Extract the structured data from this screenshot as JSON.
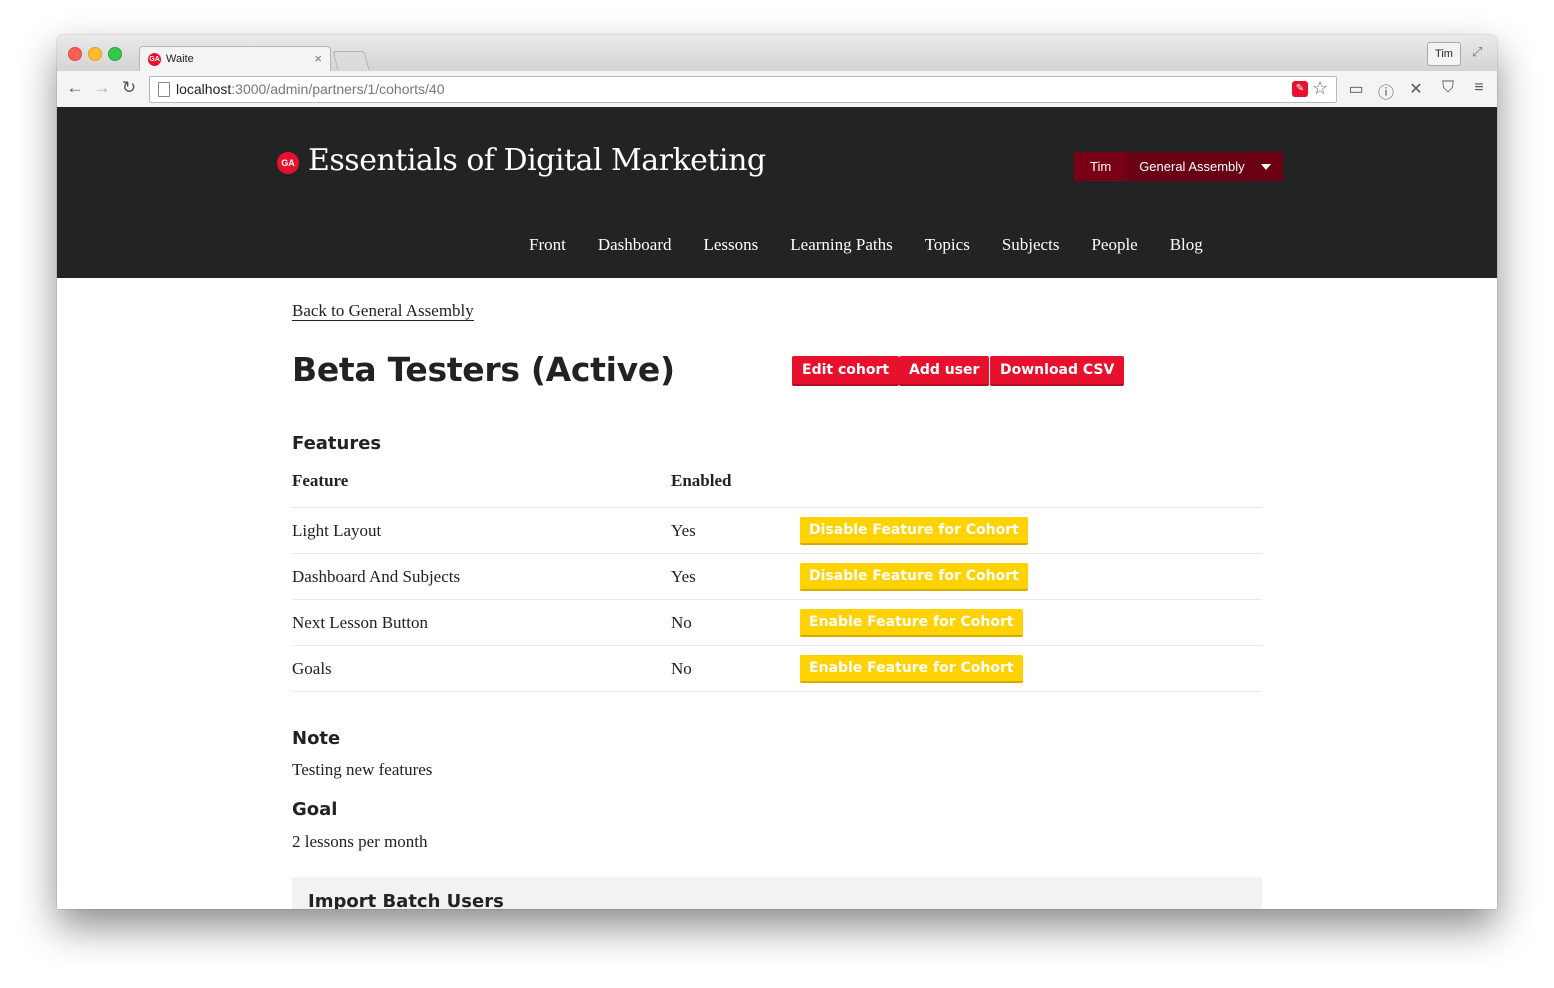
{
  "browser": {
    "tab_title": "Waite",
    "tab_favicon": "GA",
    "close_glyph": "×",
    "profile_label": "Tim",
    "url_host": "localhost",
    "url_path": ":3000/admin/partners/1/cohorts/40"
  },
  "header": {
    "logo_text": "GA",
    "site_title": "Essentials of Digital Marketing",
    "user_name": "Tim",
    "org_name": "General Assembly",
    "nav": [
      "Front",
      "Dashboard",
      "Lessons",
      "Learning Paths",
      "Topics",
      "Subjects",
      "People",
      "Blog"
    ]
  },
  "page": {
    "back_link": "Back to General Assembly",
    "title": "Beta Testers (Active)",
    "actions": {
      "edit": "Edit cohort",
      "add_user": "Add user",
      "download": "Download CSV"
    },
    "features_heading": "Features",
    "table": {
      "col_feature": "Feature",
      "col_enabled": "Enabled",
      "rows": [
        {
          "feature": "Light Layout",
          "enabled": "Yes",
          "action": "Disable Feature for Cohort"
        },
        {
          "feature": "Dashboard And Subjects",
          "enabled": "Yes",
          "action": "Disable Feature for Cohort"
        },
        {
          "feature": "Next Lesson Button",
          "enabled": "No",
          "action": "Enable Feature for Cohort"
        },
        {
          "feature": "Goals",
          "enabled": "No",
          "action": "Enable Feature for Cohort"
        }
      ]
    },
    "note_heading": "Note",
    "note_text": "Testing new features",
    "goal_heading": "Goal",
    "goal_text": "2 lessons per month",
    "import_heading": "Import Batch Users"
  },
  "colors": {
    "header_bg": "#232323",
    "brand_red": "#e8112d",
    "feature_yellow": "#ffd200",
    "user_menu": "#6b0012"
  }
}
